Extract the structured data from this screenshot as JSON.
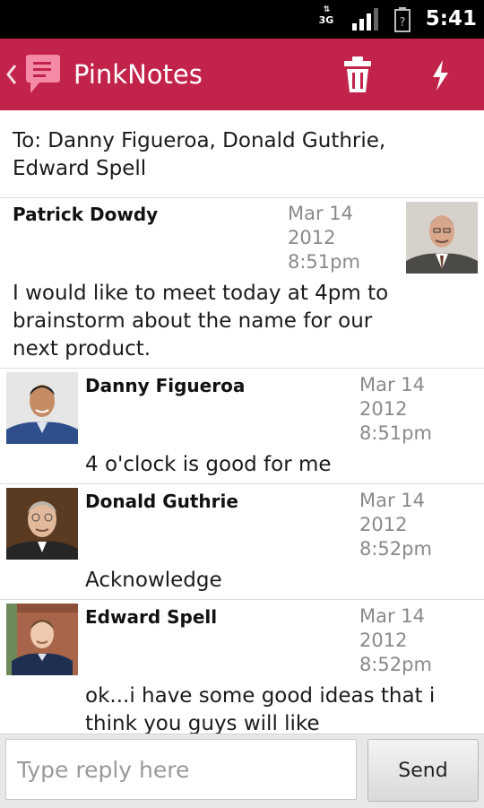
{
  "status_bar": {
    "network": "3G",
    "time": "5:41",
    "icons": [
      "data-transfer-icon",
      "signal-icon",
      "battery-icon"
    ]
  },
  "app_bar": {
    "title": "PinkNotes",
    "color": "#c2234b",
    "icons": [
      "back-chevron-icon",
      "pinknotes-logo-icon",
      "trash-icon",
      "flash-icon"
    ]
  },
  "recipients": {
    "text": "To: Danny Figueroa, Donald Guthrie, Edward Spell"
  },
  "messages": [
    {
      "sender": "Patrick Dowdy",
      "date": "Mar 14",
      "year": "2012",
      "time": "8:51pm",
      "text": "I would like to meet today at 4pm to brainstorm about the name for our next product."
    },
    {
      "sender": "Danny Figueroa",
      "date": "Mar 14",
      "year": "2012",
      "time": "8:51pm",
      "text": "4 o'clock is good for me"
    },
    {
      "sender": "Donald Guthrie",
      "date": "Mar 14",
      "year": "2012",
      "time": "8:52pm",
      "text": "Acknowledge"
    },
    {
      "sender": "Edward Spell",
      "date": "Mar 14",
      "year": "2012",
      "time": "8:52pm",
      "text": "ok...i have some good ideas that i think you guys will like"
    }
  ],
  "composer": {
    "placeholder": "Type reply here",
    "send_label": "Send"
  }
}
